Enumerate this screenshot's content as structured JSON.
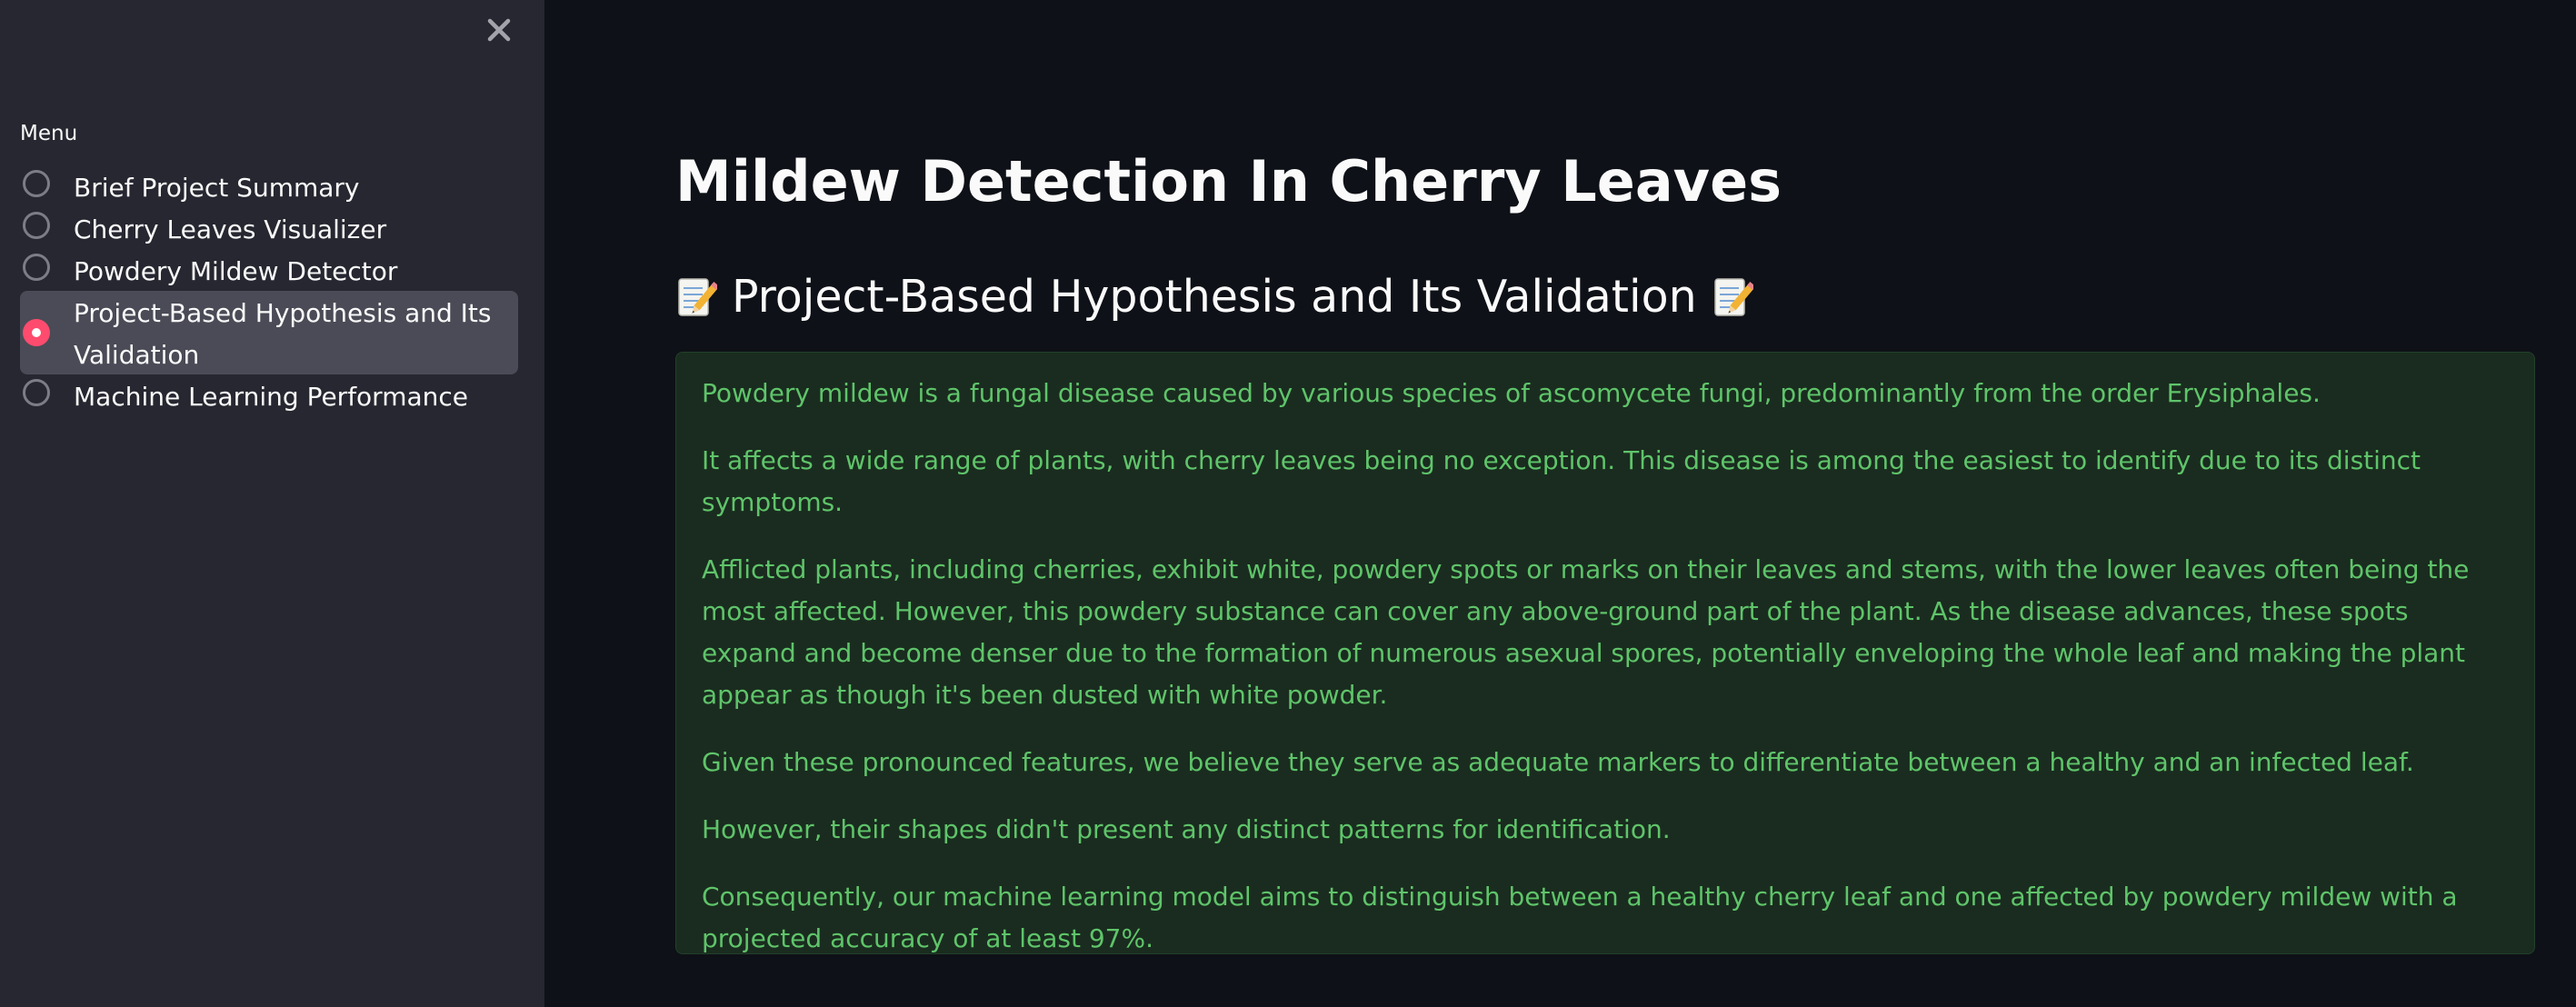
{
  "sidebar": {
    "close_icon": "close-icon",
    "menu_label": "Menu",
    "items": [
      {
        "label": "Brief Project Summary",
        "selected": false
      },
      {
        "label": "Cherry Leaves Visualizer",
        "selected": false
      },
      {
        "label": "Powdery Mildew Detector",
        "selected": false
      },
      {
        "label": "Project-Based Hypothesis and Its Validation",
        "selected": true
      },
      {
        "label": "Machine Learning Performance",
        "selected": false
      }
    ]
  },
  "main": {
    "title": "Mildew Detection In Cherry Leaves",
    "section_heading": "Project-Based Hypothesis and Its Validation",
    "section_icon": "memo-icon",
    "paragraphs": [
      "Powdery mildew is a fungal disease caused by various species of ascomycete fungi, predominantly from the order Erysiphales.",
      "It affects a wide range of plants, with cherry leaves being no exception. This disease is among the easiest to identify due to its distinct symptoms.",
      "Afflicted plants, including cherries, exhibit white, powdery spots or marks on their leaves and stems, with the lower leaves often being the most affected. However, this powdery substance can cover any above-ground part of the plant. As the disease advances, these spots expand and become denser due to the formation of numerous asexual spores, potentially enveloping the whole leaf and making the plant appear as though it's been dusted with white powder.",
      "Given these pronounced features, we believe they serve as adequate markers to differentiate between a healthy and an infected leaf.",
      "However, their shapes didn't present any distinct patterns for identification.",
      "Consequently, our machine learning model aims to distinguish between a healthy cherry leaf and one affected by powdery mildew with a projected accuracy of at least 97%."
    ]
  },
  "colors": {
    "background": "#0e1117",
    "sidebar": "#262730",
    "accent": "#ff4b6e",
    "success_text": "#5fc46a",
    "success_bg": "#1a2c1f"
  }
}
